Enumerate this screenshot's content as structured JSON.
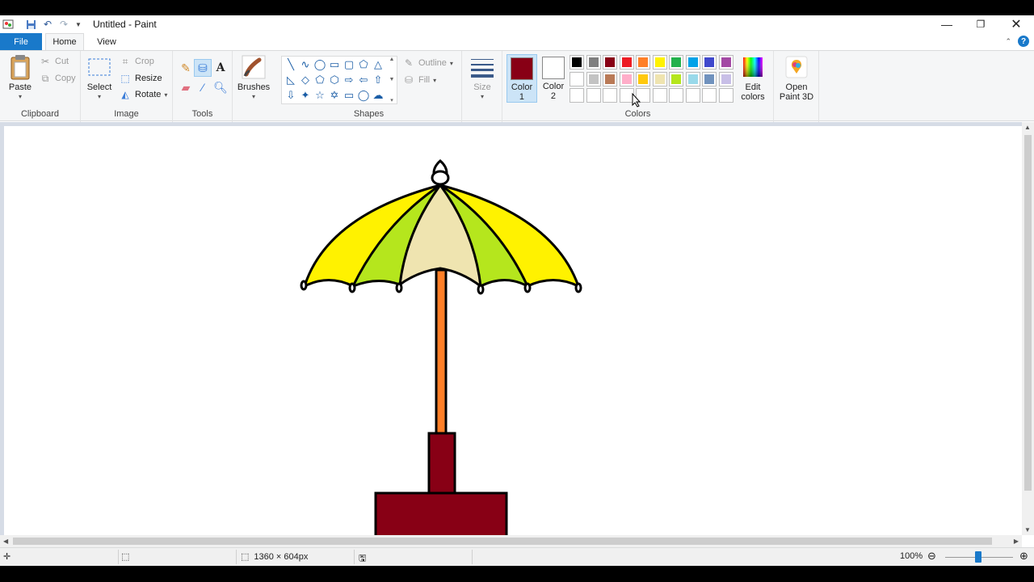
{
  "titlebar": {
    "title": "Untitled - Paint",
    "qa_icons": [
      "paint-app-icon",
      "save-icon",
      "undo-icon",
      "redo-icon",
      "customize-dropdown-icon"
    ],
    "controls": [
      "minimize",
      "restore",
      "close"
    ]
  },
  "tabs": {
    "file": "File",
    "home": "Home",
    "view": "View"
  },
  "ribbon": {
    "clipboard": {
      "label": "Clipboard",
      "paste": "Paste",
      "cut": "Cut",
      "copy": "Copy"
    },
    "image": {
      "label": "Image",
      "select": "Select",
      "crop": "Crop",
      "resize": "Resize",
      "rotate": "Rotate"
    },
    "tools": {
      "label": "Tools",
      "items": [
        "pencil-icon",
        "fill-bucket-icon",
        "text-icon",
        "eraser-icon",
        "color-picker-icon",
        "magnifier-icon"
      ],
      "selected": "fill-bucket-icon"
    },
    "brushes": {
      "label": "Brushes"
    },
    "shapes": {
      "label": "Shapes",
      "outline": "Outline",
      "fill": "Fill"
    },
    "size": {
      "label": "Size"
    },
    "colors": {
      "label": "Colors",
      "color1_label": "Color\n1",
      "color1_value": "#880015",
      "color2_label": "Color\n2",
      "color2_value": "#ffffff",
      "edit_colors": "Edit colors",
      "palette_row1": [
        "#000000",
        "#7f7f7f",
        "#880015",
        "#ed1c24",
        "#ff7f27",
        "#fff200",
        "#22b14c",
        "#00a2e8",
        "#3f48cc",
        "#a349a4"
      ],
      "palette_row2": [
        "#ffffff",
        "#c3c3c3",
        "#b97a57",
        "#ffaec9",
        "#ffc90e",
        "#efe4b0",
        "#b5e61d",
        "#99d9ea",
        "#7092be",
        "#c8bfe7"
      ]
    },
    "paint3d": {
      "label": "Open Paint 3D"
    }
  },
  "drawing": {
    "canopy_colors": [
      "#fff200",
      "#b5e61d",
      "#efe4b0",
      "#b5e61d",
      "#fff200"
    ],
    "pole_color": "#ff7f27",
    "base_color": "#880015",
    "outline_color": "#000000"
  },
  "status": {
    "canvas_size": "1360 × 604px",
    "zoom": "100%"
  }
}
